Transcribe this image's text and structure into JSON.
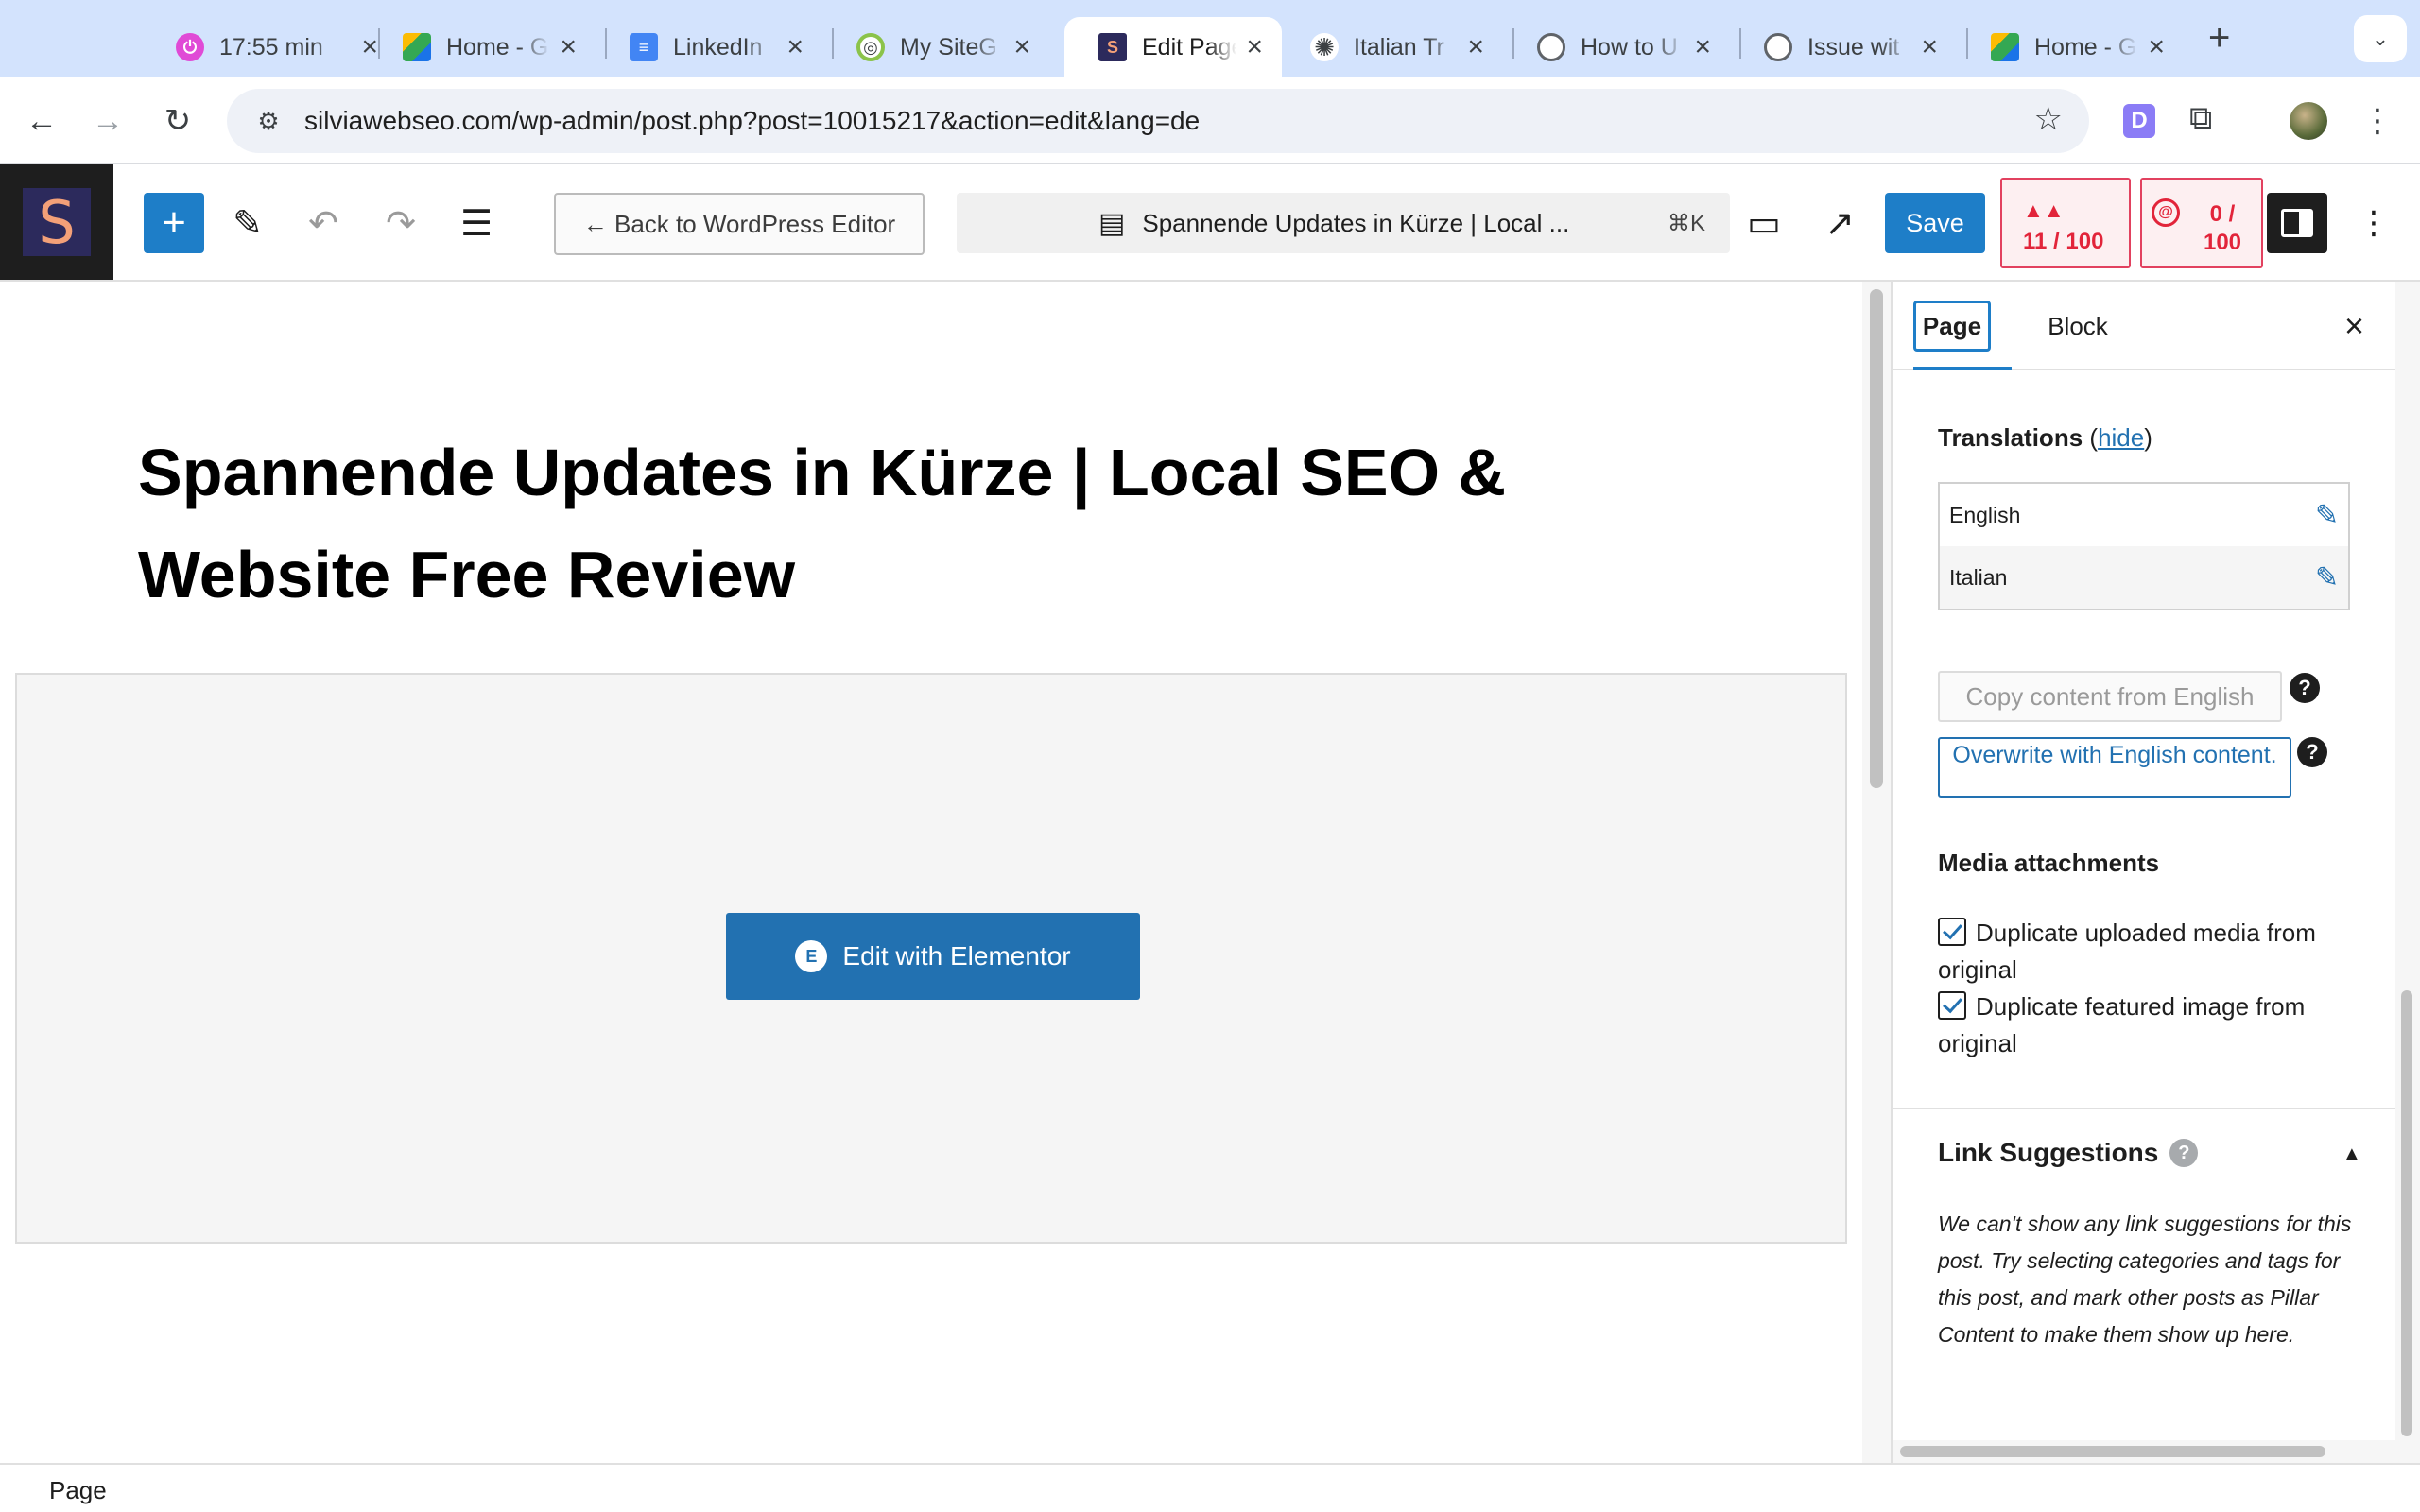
{
  "browser": {
    "tabs": [
      {
        "title": "17:55 min",
        "icon": "timer-icon",
        "color": "#e04ad6"
      },
      {
        "title": "Home - G",
        "icon": "google-drive-icon",
        "color": "#1a73e8"
      },
      {
        "title": "LinkedIn",
        "icon": "google-docs-icon",
        "color": "#4285f4"
      },
      {
        "title": "My SiteG",
        "icon": "sitecheck-icon",
        "color": "#8bc34a"
      },
      {
        "title": "Edit Page",
        "icon": "site-s-icon",
        "color": "#2c2a5c"
      },
      {
        "title": "Italian Tr",
        "icon": "openai-icon",
        "color": "#3c4043"
      },
      {
        "title": "How to U",
        "icon": "support-icon",
        "color": "#3c4043"
      },
      {
        "title": "Issue wit",
        "icon": "support-icon",
        "color": "#3c4043"
      },
      {
        "title": "Home - G",
        "icon": "google-drive-icon",
        "color": "#1a73e8"
      }
    ],
    "url": "silviawebseo.com/wp-admin/post.php?post=10015217&action=edit&lang=de",
    "extension_letter": "D"
  },
  "editor": {
    "site_letter": "S",
    "back_button": "← Back to WordPress Editor",
    "doc_title": "Spannende Updates in Kürze | Local ...",
    "shortcut": "⌘K",
    "save": "Save",
    "score1": "11 / 100",
    "score2": "0 / 100"
  },
  "post": {
    "title": "Spannende Updates in Kürze | Local SEO & Website Free Review",
    "elementor_button": "Edit with Elementor"
  },
  "sidebar": {
    "tab_page": "Page",
    "tab_block": "Block",
    "translations_label": "Translations",
    "hide_link": "hide",
    "languages": [
      "English",
      "Italian"
    ],
    "copy_button": "Copy content from English",
    "overwrite_button": "Overwrite with English content.",
    "media_heading": "Media attachments",
    "checkbox_media": "Duplicate uploaded media from original",
    "checkbox_featured": "Duplicate featured image from original",
    "link_heading": "Link Suggestions",
    "link_body": "We can't show any link suggestions for this post. Try selecting categories and tags for this post, and mark other posts as Pillar Content to make them show up here."
  },
  "footer": {
    "breadcrumb": "Page"
  }
}
